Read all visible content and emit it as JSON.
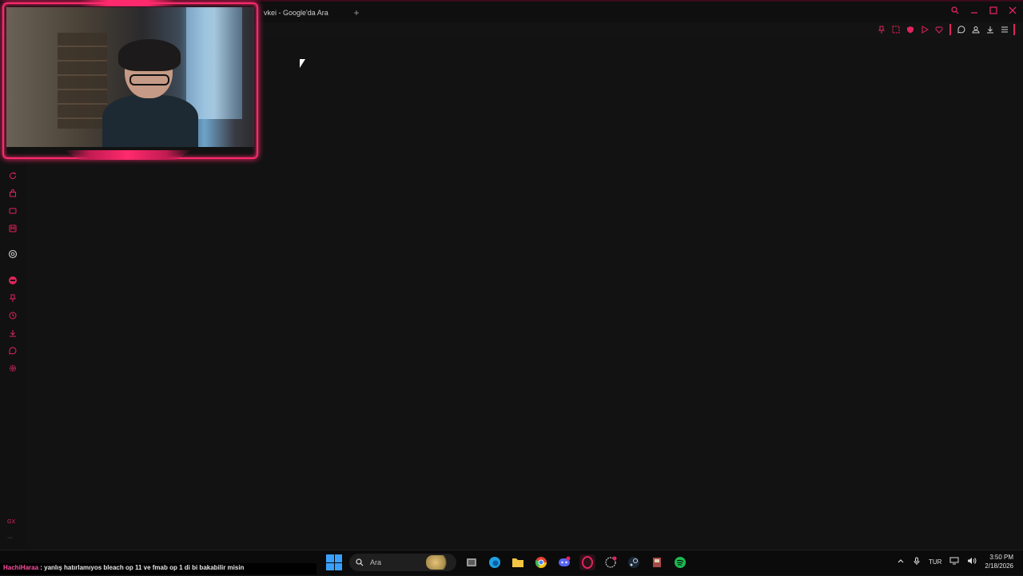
{
  "browser": {
    "tab_title": "vkei - Google'da Ara",
    "new_tab_symbol": "+",
    "accent_color": "#e0245e",
    "window_controls": [
      "search-icon",
      "minimize-icon",
      "maximize-icon",
      "close-icon"
    ],
    "toolbar_icons": [
      "pin-icon",
      "snapshot-icon",
      "shield-icon",
      "play-icon",
      "heart-icon",
      "chat-icon",
      "profile-icon",
      "download-icon",
      "menu-icon"
    ],
    "sidebar_icons": [
      "refresh-icon",
      "bag-icon",
      "tv-icon",
      "map-icon",
      "chatgpt-icon",
      "record-icon",
      "pin-icon",
      "history-icon",
      "download-icon",
      "message-icon",
      "settings-icon"
    ],
    "sidebar_footer_text": "GX",
    "sidebar_more": "···"
  },
  "stream_chat": {
    "username": "HachiHaraa",
    "separator": " : ",
    "message": "yanlış hatırlamıyos bleach op 11 ve fmab op 1 di bi bakabilir misin"
  },
  "taskbar": {
    "search_placeholder": "Ara",
    "apps": [
      "task-view-icon",
      "edge-icon",
      "file-explorer-icon",
      "chrome-icon",
      "discord-icon",
      "opera-gx-icon",
      "clock-app-icon",
      "steam-icon",
      "game-icon",
      "spotify-icon"
    ],
    "tray": {
      "language": "TUR",
      "time": "3:50 PM",
      "date": "2/18/2026"
    }
  }
}
